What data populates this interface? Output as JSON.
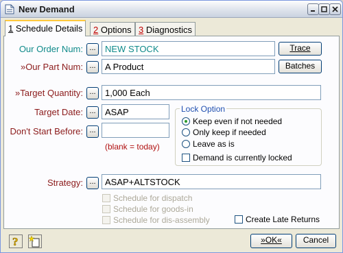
{
  "window": {
    "title": "New Demand"
  },
  "tabs": [
    {
      "num": "1",
      "label": " Schedule Details"
    },
    {
      "num": "2",
      "label": " Options"
    },
    {
      "num": "3",
      "label": " Diagnostics"
    }
  ],
  "form": {
    "order_num": {
      "label": "Our Order Num:",
      "value": "NEW STOCK"
    },
    "part_num": {
      "label": "»Our Part Num:",
      "value": "A Product"
    },
    "target_qty": {
      "label": "»Target Quantity:",
      "value": "1,000 Each"
    },
    "target_date": {
      "label": "Target Date:",
      "value": "ASAP"
    },
    "dont_start": {
      "label": "Don't Start Before:",
      "value": "",
      "hint": "(blank = today)"
    },
    "strategy": {
      "label": "Strategy:",
      "value": "ASAP+ALTSTOCK"
    },
    "more_button": "..."
  },
  "buttons": {
    "trace": "Trace",
    "batches": "Batches",
    "ok": "»OK«",
    "cancel": "Cancel"
  },
  "lock_option": {
    "title": "Lock Option",
    "options": [
      "Keep even if not needed",
      "Only keep if needed",
      "Leave as is"
    ],
    "selected": 0,
    "locked_checkbox": "Demand is currently locked"
  },
  "schedule_checks": [
    "Schedule for dispatch",
    "Schedule for goods-in",
    "Schedule for dis-assembly"
  ],
  "create_late_returns": "Create Late Returns",
  "icons": {
    "help": "help-question-icon",
    "new": "new-document-icon",
    "app": "document-icon"
  },
  "colors": {
    "teal_label": "#0f8a8a",
    "red_label": "#8b1a1a",
    "group_title": "#1f4fb0"
  }
}
